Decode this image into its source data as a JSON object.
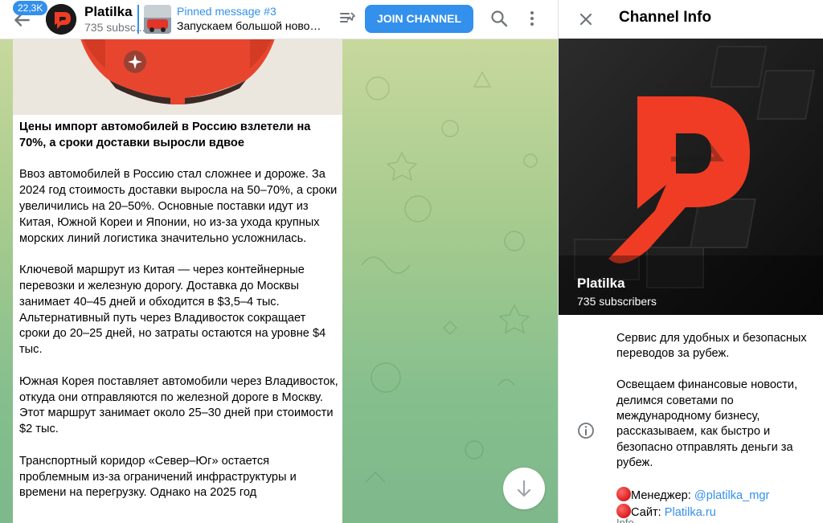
{
  "header": {
    "unread_count": "22,3K",
    "channel_name": "Platilka",
    "subscribers_short": "735 subsc...",
    "pinned_title": "Pinned message #3",
    "pinned_text": "Запускаем большой нового...",
    "join_label": "JOIN CHANNEL"
  },
  "message": {
    "headline": "Цены импорт автомобилей в Россию взлетели на 70%, а сроки доставки выросли вдвое",
    "paragraphs": [
      "Ввоз автомобилей в Россию стал сложнее и дороже. За 2024 год стоимость доставки выросла на 50–70%, а сроки увеличились на 20–50%. Основные поставки идут из Китая, Южной Кореи и Японии, но из-за ухода крупных морских линий логистика значительно усложнилась.",
      "Ключевой маршрут из Китая — через контейнерные перевозки и железную дорогу. Доставка до Москвы занимает 40–45 дней и обходится в $3,5–4 тыс. Альтернативный путь через Владивосток сокращает сроки до 20–25 дней, но затраты остаются на уровне $4 тыс.",
      "Южная Корея поставляет автомобили через Владивосток, откуда они отправляются по железной дороге в Москву. Этот маршрут занимает около 25–30 дней при стоимости $2 тыс.",
      "Транспортный коридор «Север–Юг» остается проблемным из-за ограничений инфраструктуры и времени на перегрузку. Однако на 2025 год"
    ]
  },
  "info_panel": {
    "title": "Channel Info",
    "channel_name": "Platilka",
    "subscribers": "735 subscribers",
    "about_1": "Сервис для удобных и безопасных переводов за рубеж.",
    "about_2": "Освещаем финансовые новости, делимся советами по международному бизнесу, рассказываем, как быстро и безопасно отправлять деньги за рубеж.",
    "manager_label": "Менеджер: ",
    "manager_link": "@platilka_mgr",
    "site_label": "Сайт: ",
    "site_link": "Platilka.ru",
    "caption": "Info"
  },
  "colors": {
    "accent": "#3390ec",
    "brand_red": "#f03c24",
    "secondary_text": "#707579"
  },
  "icons": {
    "back": "arrow-left-icon",
    "pinned_list": "pinned-list-icon",
    "search": "search-icon",
    "more": "more-vertical-icon",
    "scroll_down": "arrow-down-icon",
    "close": "close-icon",
    "info": "info-icon",
    "bullet": "red-circle-icon"
  }
}
